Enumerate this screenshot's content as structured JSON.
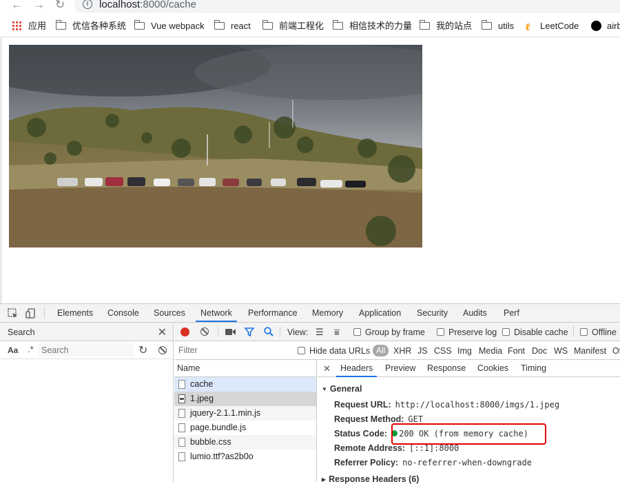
{
  "browser": {
    "url_host": "localhost",
    "url_rest": ":8000/cache",
    "bookmarks": [
      "应用",
      "优信各种系统",
      "Vue webpack",
      "react",
      "前端工程化",
      "相信技术的力量",
      "我的站点",
      "utils",
      "LeetCode",
      "airb"
    ]
  },
  "page": {
    "image_alt": "landscape photo of parked cars on a hillside"
  },
  "devtools": {
    "tabs": [
      "Elements",
      "Console",
      "Sources",
      "Network",
      "Performance",
      "Memory",
      "Application",
      "Security",
      "Audits",
      "Perf"
    ],
    "active_tab": "Network",
    "search_panel": {
      "title": "Search",
      "case_label": "Aa",
      "regex_label": ".*",
      "placeholder": "Search"
    },
    "network_toolbar": {
      "view_label": "View:",
      "group_by_frame": "Group by frame",
      "preserve_log": "Preserve log",
      "disable_cache": "Disable cache",
      "offline": "Offline"
    },
    "filter_bar": {
      "placeholder": "Filter",
      "hide_data_urls": "Hide data URLs",
      "types": [
        "All",
        "XHR",
        "JS",
        "CSS",
        "Img",
        "Media",
        "Font",
        "Doc",
        "WS",
        "Manifest",
        "Ot"
      ]
    },
    "requests": {
      "column_name": "Name",
      "rows": [
        "cache",
        "1.jpeg",
        "jquery-2.1.1.min.js",
        "page.bundle.js",
        "bubble.css",
        "lumio.ttf?as2b0o"
      ],
      "selected": "1.jpeg"
    },
    "detail": {
      "tabs": [
        "Headers",
        "Preview",
        "Response",
        "Cookies",
        "Timing"
      ],
      "active_tab": "Headers",
      "general_title": "General",
      "fields": [
        {
          "key": "Request URL:",
          "value": "http://localhost:8000/imgs/1.jpeg"
        },
        {
          "key": "Request Method:",
          "value": "GET"
        },
        {
          "key": "Status Code:",
          "value": "200 OK (from memory cache)"
        },
        {
          "key": "Remote Address:",
          "value": "[::1]:8000"
        },
        {
          "key": "Referrer Policy:",
          "value": "no-referrer-when-downgrade"
        }
      ],
      "response_headers_title": "Response Headers (6)"
    }
  }
}
